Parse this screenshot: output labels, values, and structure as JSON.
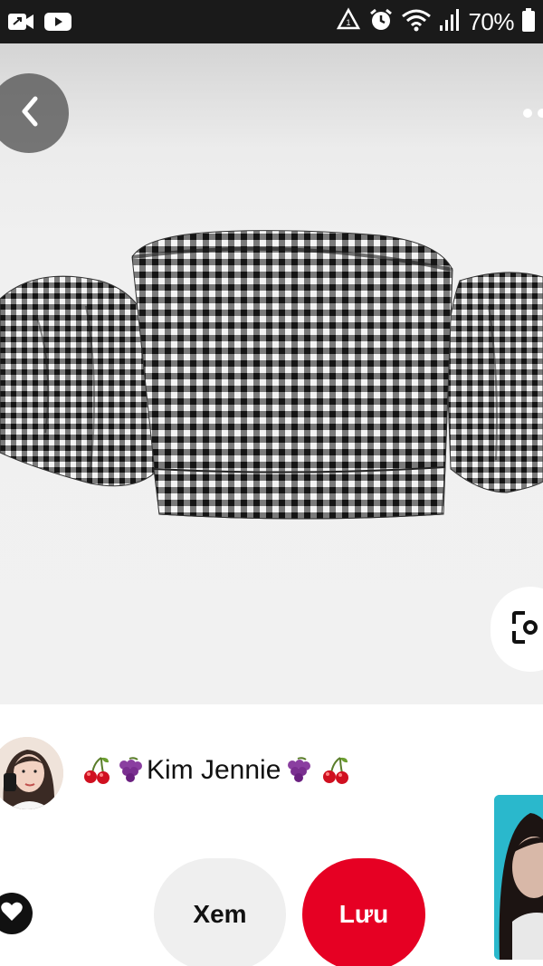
{
  "status_bar": {
    "battery_percent": "70%",
    "left_icons": [
      "video-call-icon",
      "youtube-icon"
    ],
    "right_icons": [
      "data-saver-icon",
      "alarm-icon",
      "wifi-icon",
      "signal-icon",
      "battery-icon"
    ]
  },
  "pin": {
    "page_count": 2,
    "image_description_icon": "gingham-off-shoulder-crop-top"
  },
  "creator": {
    "name": "Kim Jennie",
    "emoji_left": [
      "cherry",
      "grapes"
    ],
    "emoji_right": [
      "grapes",
      "cherry"
    ]
  },
  "actions": {
    "view_label": "Xem",
    "save_label": "Lưu"
  },
  "colors": {
    "save_red": "#e60023",
    "view_gray": "#efefef",
    "status_bar": "#1a1a1a"
  }
}
